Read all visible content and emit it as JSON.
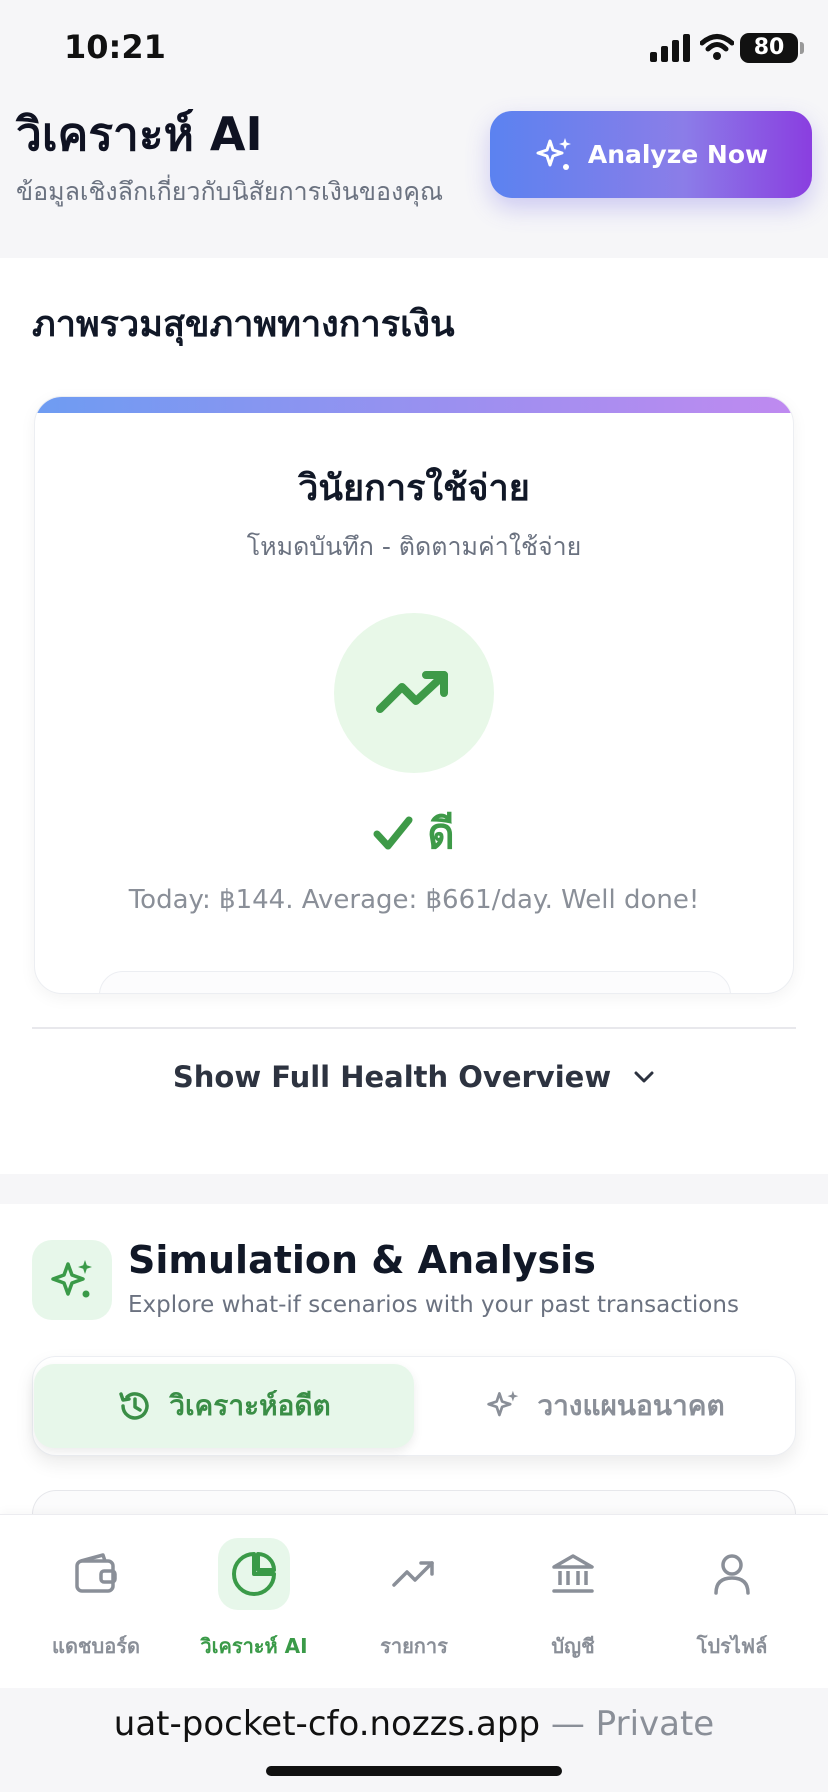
{
  "status_bar": {
    "time": "10:21",
    "battery": "80"
  },
  "header": {
    "title": "วิเคราะห์ AI",
    "subtitle": "ข้อมูลเชิงลึกเกี่ยวกับนิสัยการเงินของคุณ",
    "analyze_button": "Analyze Now"
  },
  "health": {
    "section_title": "ภาพรวมสุขภาพทางการเงิน",
    "card": {
      "title": "วินัยการใช้จ่าย",
      "subtitle": "โหมดบันทึก - ติดตามค่าใช้จ่าย",
      "icon": "trending-up-icon",
      "status_label": "ดี",
      "message": "Today: ฿144. Average: ฿661/day. Well done!"
    },
    "show_full_label": "Show Full Health Overview"
  },
  "simulation": {
    "title": "Simulation & Analysis",
    "subtitle": "Explore what-if scenarios with your past transactions",
    "tabs": [
      {
        "label": "วิเคราะห์อดีต",
        "icon": "history-icon",
        "active": true
      },
      {
        "label": "วางแผนอนาคต",
        "icon": "sparkles-icon",
        "active": false
      }
    ]
  },
  "bottom_nav": [
    {
      "label": "แดชบอร์ด",
      "icon": "wallet-icon",
      "active": false
    },
    {
      "label": "วิเคราะห์ AI",
      "icon": "pie-chart-icon",
      "active": true
    },
    {
      "label": "รายการ",
      "icon": "trending-up-icon",
      "active": false
    },
    {
      "label": "บัญชี",
      "icon": "bank-icon",
      "active": false
    },
    {
      "label": "โปรไฟล์",
      "icon": "user-icon",
      "active": false
    }
  ],
  "browser": {
    "url": "uat-pocket-cfo.nozzs.app",
    "suffix": "— Private"
  },
  "colors": {
    "accent_green": "#3a9a48",
    "gradient_start": "#5b82f0",
    "gradient_end": "#8a3ee0"
  }
}
